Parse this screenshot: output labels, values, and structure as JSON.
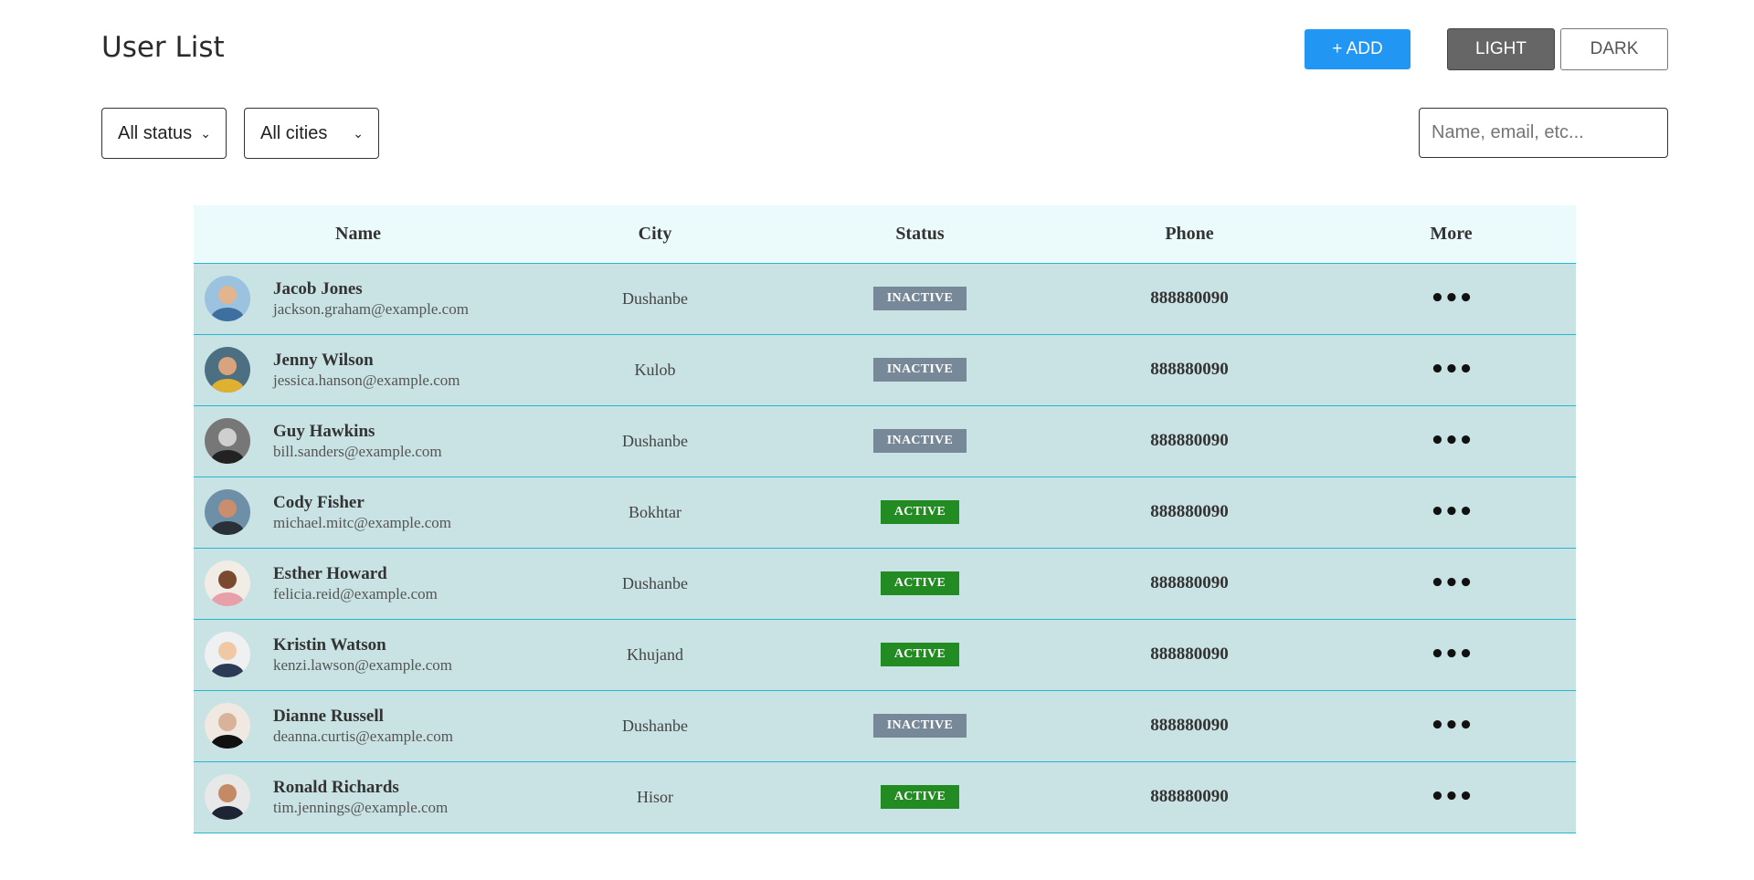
{
  "header": {
    "title": "User List",
    "add_label": "+ ADD",
    "light_label": "LIGHT",
    "dark_label": "DARK"
  },
  "filters": {
    "status_value": "All status",
    "city_value": "All cities"
  },
  "search": {
    "placeholder": "Name, email, etc..."
  },
  "table": {
    "columns": [
      "Name",
      "City",
      "Status",
      "Phone",
      "More"
    ],
    "rows": [
      {
        "name": "Jacob Jones",
        "email": "jackson.graham@example.com",
        "city": "Dushanbe",
        "status": "INACTIVE",
        "phone": "888880090",
        "more": "•••",
        "avatar_icon": "user-avatar-icon"
      },
      {
        "name": "Jenny Wilson",
        "email": "jessica.hanson@example.com",
        "city": "Kulob",
        "status": "INACTIVE",
        "phone": "888880090",
        "more": "•••",
        "avatar_icon": "user-avatar-icon"
      },
      {
        "name": "Guy Hawkins",
        "email": "bill.sanders@example.com",
        "city": "Dushanbe",
        "status": "INACTIVE",
        "phone": "888880090",
        "more": "•••",
        "avatar_icon": "user-avatar-icon"
      },
      {
        "name": "Cody Fisher",
        "email": "michael.mitc@example.com",
        "city": "Bokhtar",
        "status": "ACTIVE",
        "phone": "888880090",
        "more": "•••",
        "avatar_icon": "user-avatar-icon"
      },
      {
        "name": "Esther Howard",
        "email": "felicia.reid@example.com",
        "city": "Dushanbe",
        "status": "ACTIVE",
        "phone": "888880090",
        "more": "•••",
        "avatar_icon": "user-avatar-icon"
      },
      {
        "name": "Kristin Watson",
        "email": "kenzi.lawson@example.com",
        "city": "Khujand",
        "status": "ACTIVE",
        "phone": "888880090",
        "more": "•••",
        "avatar_icon": "user-avatar-icon"
      },
      {
        "name": "Dianne Russell",
        "email": "deanna.curtis@example.com",
        "city": "Dushanbe",
        "status": "INACTIVE",
        "phone": "888880090",
        "more": "•••",
        "avatar_icon": "user-avatar-icon"
      },
      {
        "name": "Ronald Richards",
        "email": "tim.jennings@example.com",
        "city": "Hisor",
        "status": "ACTIVE",
        "phone": "888880090",
        "more": "•••",
        "avatar_icon": "user-avatar-icon"
      }
    ]
  },
  "colors": {
    "accent": "#2196f3",
    "active": "#228b22",
    "inactive": "#778899",
    "row_bg": "#c9e2e3",
    "header_bg": "#ebfafa",
    "row_border": "#29b6cc"
  }
}
